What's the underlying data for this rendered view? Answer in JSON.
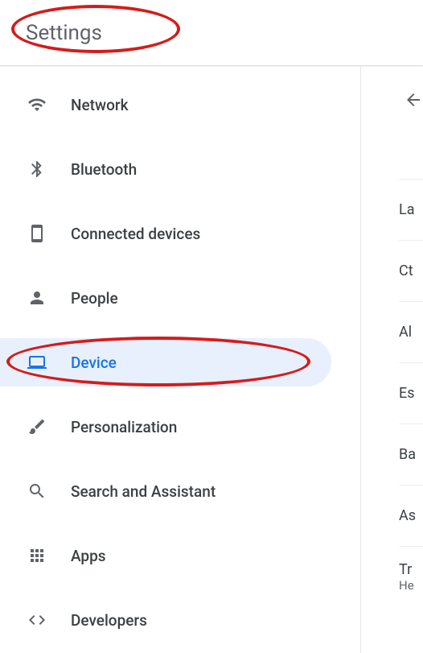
{
  "header": {
    "title": "Settings"
  },
  "sidebar": {
    "items": [
      {
        "label": "Network"
      },
      {
        "label": "Bluetooth"
      },
      {
        "label": "Connected devices"
      },
      {
        "label": "People"
      },
      {
        "label": "Device"
      },
      {
        "label": "Personalization"
      },
      {
        "label": "Search and Assistant"
      },
      {
        "label": "Apps"
      },
      {
        "label": "Developers"
      }
    ],
    "selected_index": 4
  },
  "right": {
    "rows": [
      "La",
      "Ct",
      "Al",
      "Es",
      "Ba",
      "As"
    ],
    "final": {
      "line1": "Tr",
      "line2": "He"
    }
  }
}
